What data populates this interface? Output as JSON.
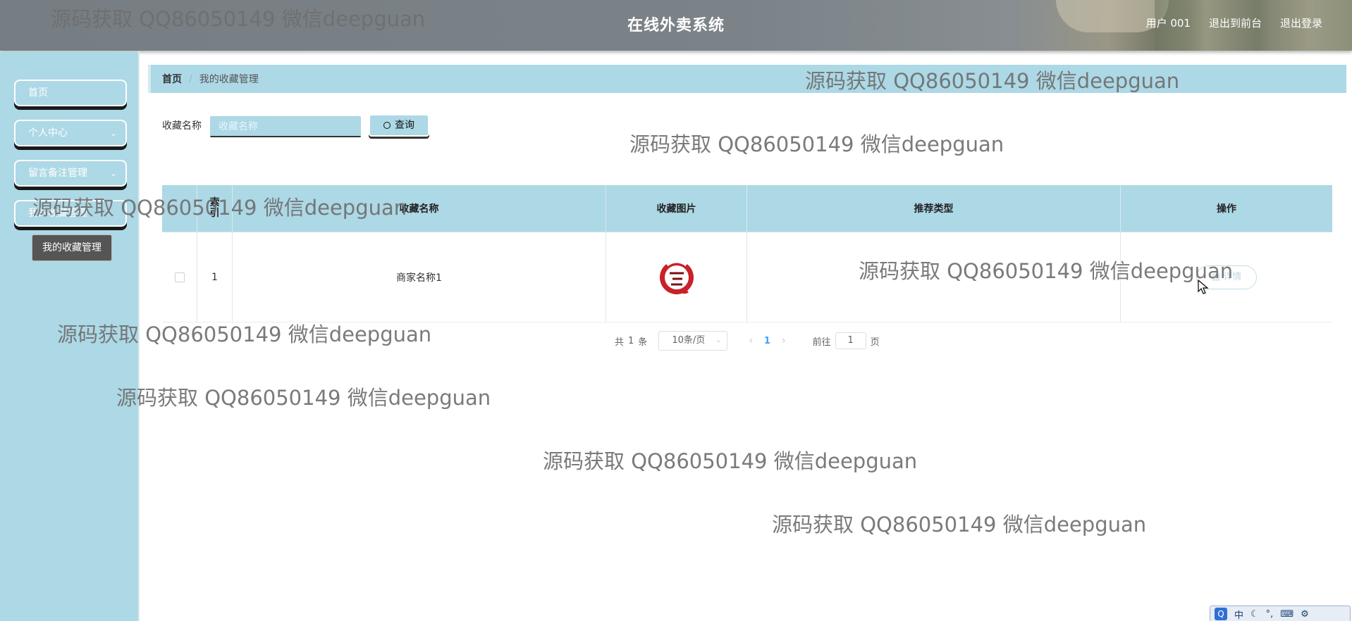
{
  "header": {
    "title": "在线外卖系统",
    "user_label": "用户 001",
    "back_to_front": "退出到前台",
    "logout": "退出登录"
  },
  "sidebar": {
    "items": [
      {
        "label": "首页"
      },
      {
        "label": "个人中心"
      },
      {
        "label": "留言备注管理"
      },
      {
        "label": "我的收藏管理"
      }
    ],
    "submenu_active": "我的收藏管理"
  },
  "breadcrumb": {
    "home": "首页",
    "current": "我的收藏管理"
  },
  "search": {
    "label": "收藏名称",
    "placeholder": "收藏名称",
    "button": "查询"
  },
  "table": {
    "headers": [
      "",
      "索引",
      "收藏名称",
      "收藏图片",
      "推荐类型",
      "操作"
    ],
    "rows": [
      {
        "index": "1",
        "name": "商家名称1",
        "image_icon": "restaurant-logo-icon",
        "type": "",
        "action": "详情"
      }
    ]
  },
  "pagination": {
    "total_prefix": "共",
    "total": "1",
    "total_suffix": "条",
    "page_size": "10条/页",
    "current_page": "1",
    "goto_prefix": "前往",
    "goto_value": "1",
    "goto_suffix": "页"
  },
  "watermark": "源码获取 QQ86050149 微信deepguan",
  "ime": {
    "lang": "中"
  },
  "colors": {
    "accent": "#add8e6",
    "header": "#7b8389",
    "submenu": "#555555",
    "active_page": "#409eff"
  }
}
